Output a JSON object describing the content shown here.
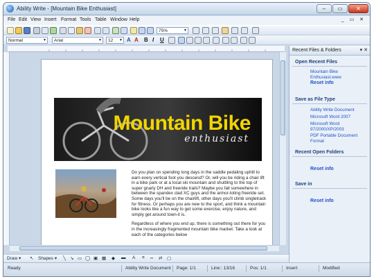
{
  "window": {
    "title": "Ability Write - [Mountain Bike Enthusiast]",
    "min": "–",
    "max": "▭",
    "close": "✕"
  },
  "menu": [
    "File",
    "Edit",
    "View",
    "Insert",
    "Format",
    "Tools",
    "Table",
    "Window",
    "Help"
  ],
  "doc_controls": "_ ▭ ✕",
  "toolbar": {
    "zoom": "75%"
  },
  "format": {
    "style": "Normal",
    "font": "Arial",
    "size": "12",
    "bold": "B",
    "italic": "I",
    "underline": "U"
  },
  "banner": {
    "title": "Mountain Bike",
    "subtitle": "enthusiast"
  },
  "body": {
    "para1": "Do you plan on spending long days in the saddle pedaling uphill to earn every vertical foot you descend? Or, will you be riding a chair lift in a bike park or at a local ski mountain and shuttling to the top of super gnarly DH and freeride trails? Maybe you fall somewhere in between the spandex clad XC guys and the armor-toting freeride set. Some days you'll be on the chairlift, other days you'll climb singletrack for fitness. Or perhaps you are new to the sport, and think a mountain bike looks like a fun way to get some exercise, enjoy nature, and simply get around town-it is.",
    "para2": "Regardless of where you end up, there is something out there for you in the increasingly fragmented mountain bike market. Take a look at each of the categories below"
  },
  "panel": {
    "title": "Recent Files & Folders",
    "controls": "▾ ✕",
    "open_recent": "Open Recent Files",
    "recent_file": "Mountain Bike Enthusiast.www",
    "reset": "Reset info",
    "save_as": "Save as File Type",
    "types": [
      "Ability Write Document",
      "Microsoft Word 2007",
      "Microsoft Word 97/2000/XP/2003",
      "PDF Portable Document Format"
    ],
    "recent_folders": "Recent Open Folders",
    "save_in": "Save in"
  },
  "drawbar": {
    "draw": "Draw ▾",
    "shapes": "Shapes ▾"
  },
  "status": {
    "ready": "Ready",
    "doc_type": "Ability Write Document",
    "page": "Page: 1/1",
    "line": "Line:: 13/16",
    "pos": "Pos: 1/1",
    "insert": "Insert",
    "modified": "Modified"
  },
  "colors": {
    "banner_title": "#f1d500",
    "link": "#1e52c6",
    "section": "#1f3f7a"
  }
}
